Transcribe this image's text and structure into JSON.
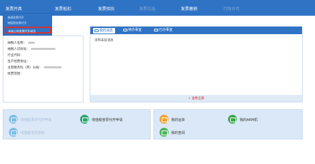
{
  "topnav": {
    "items": [
      {
        "label": "发票开具",
        "muted": false
      },
      {
        "label": "发票抵扣",
        "muted": false
      },
      {
        "label": "发票验旧",
        "muted": false
      },
      {
        "label": "发票勾选",
        "muted": true
      },
      {
        "label": "发票缴销",
        "muted": false
      },
      {
        "label": "行政许可",
        "muted": true
      }
    ]
  },
  "dropdown": {
    "items": [
      "普通发票代开",
      "增值税发票代开",
      "本省土地发票代开成功"
    ],
    "highlighted_index": 2
  },
  "taxpayer_info": {
    "rows": [
      {
        "label": "纳税人名称："
      },
      {
        "label": "纳税人识别号："
      },
      {
        "label": "行业代码："
      },
      {
        "label": "生产经营地址："
      },
      {
        "label": "主管税务科（所）分局："
      },
      {
        "label": "经营范围："
      }
    ]
  },
  "messages": {
    "tabs": [
      "我的消息",
      "待办事宜",
      "已办事宜"
    ],
    "active_tab": 0,
    "empty_text": "没有未读消息",
    "view_all": "+ 查看全部"
  },
  "shortcuts": {
    "left": [
      {
        "label": "增值税发票代开申请",
        "faded": true,
        "color": "#2f9fd8"
      },
      {
        "label": "增值税普票代开申请",
        "faded": false,
        "color": "#2aa672"
      },
      {
        "label": "增值税发票报检",
        "faded": true,
        "color": "#2f9fd8"
      }
    ],
    "right": [
      {
        "label": "我的运单",
        "faded": false,
        "color": "#f0a22a"
      },
      {
        "label": "我的ARM机",
        "faded": false,
        "color": "#3aa84c"
      },
      {
        "label": "我的查阅",
        "faded": false,
        "color": "#4ab35b"
      }
    ]
  },
  "colors": {
    "nav_bg": "#2f73c5",
    "highlight_border": "#d9322e",
    "view_all": "#d9322e",
    "panel_bg": "#dbe8f7"
  }
}
